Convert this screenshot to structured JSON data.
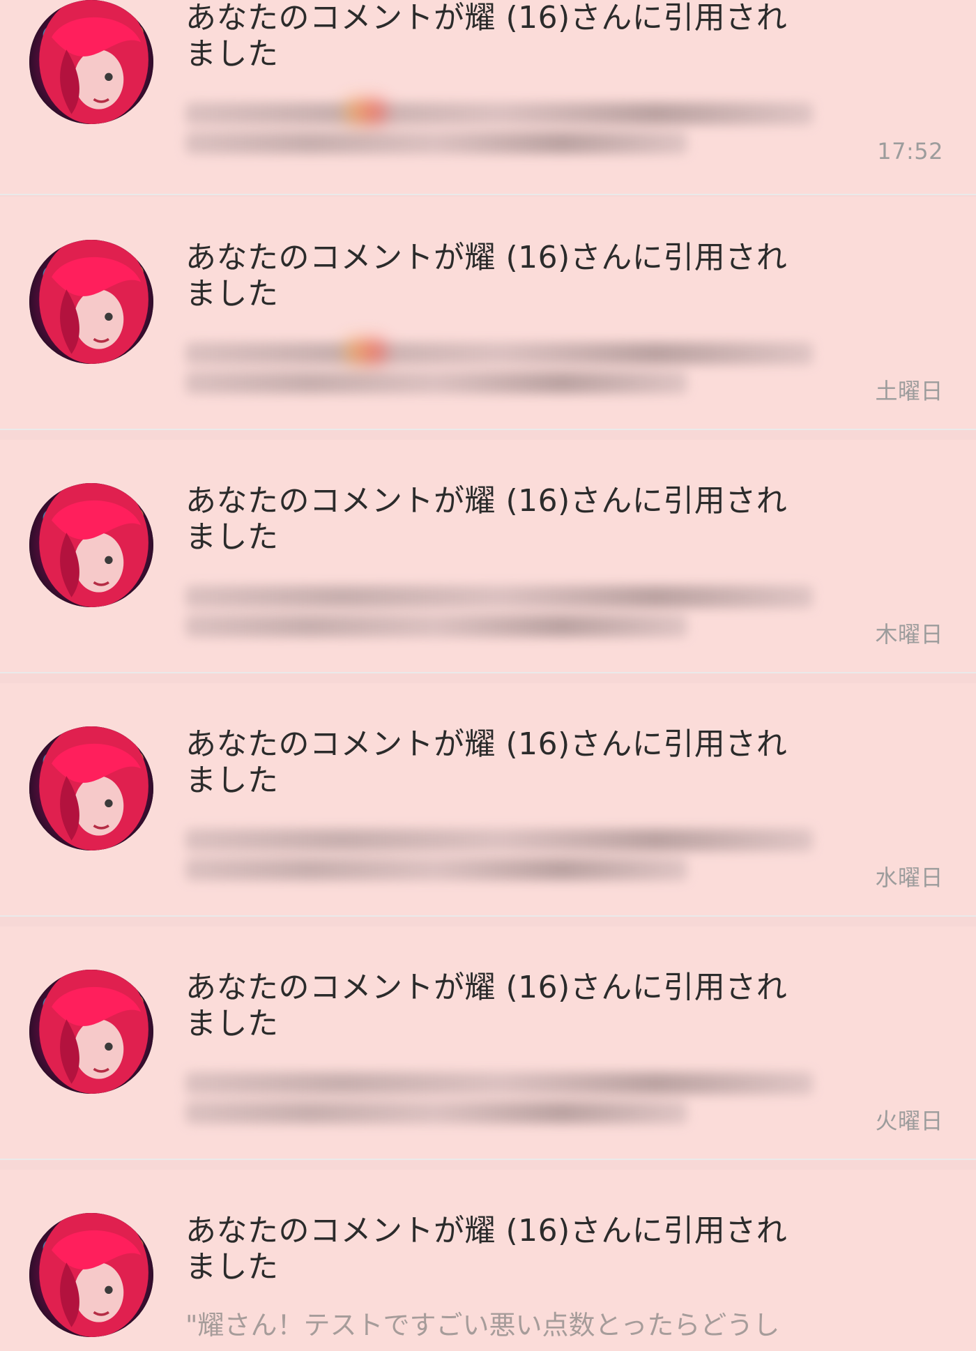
{
  "notifications": [
    {
      "title_line1": "あなたのコメントが耀 (16)さんに引用され",
      "title_line2": "ました",
      "time": "17:52"
    },
    {
      "title_line1": "あなたのコメントが耀 (16)さんに引用され",
      "title_line2": "ました",
      "time": "土曜日"
    },
    {
      "title_line1": "あなたのコメントが耀 (16)さんに引用され",
      "title_line2": "ました",
      "time": "木曜日"
    },
    {
      "title_line1": "あなたのコメントが耀 (16)さんに引用され",
      "title_line2": "ました",
      "time": "水曜日"
    },
    {
      "title_line1": "あなたのコメントが耀 (16)さんに引用され",
      "title_line2": "ました",
      "time": "火曜日"
    },
    {
      "title_line1": "あなたのコメントが耀 (16)さんに引用され",
      "title_line2": "ました",
      "preview": "\"耀さん！テストですごい悪い点数とったらどうし"
    }
  ],
  "colors": {
    "background": "#f7d8d6",
    "card": "#fbdcd9",
    "title_text": "#2b2b2b",
    "time_text": "#9c9c9c",
    "avatar_hair": "#e0204f",
    "header_strip": "#2f3a7a"
  },
  "icons": {
    "avatar": "user-avatar-photo"
  }
}
